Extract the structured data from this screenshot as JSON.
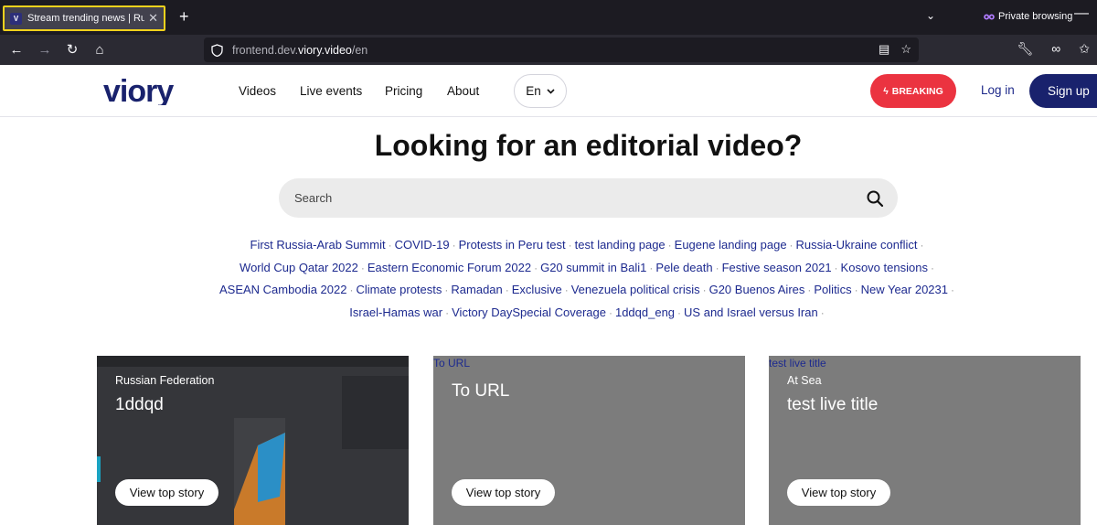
{
  "browser": {
    "tab_title": "Stream trending news | Ruptly",
    "tab_favicon": "V",
    "new_tab": "+",
    "tab_close": "✕",
    "private_label": "Private browsing",
    "url_prefix": "frontend.dev.",
    "url_host": "viory.video",
    "url_path": "/en",
    "icons": [
      "back-icon",
      "forward-icon",
      "reload-icon",
      "home-icon",
      "shield-icon",
      "reader-view-icon",
      "bookmark-star-icon",
      "wrench-icon",
      "mask-icon",
      "extensions-icon"
    ]
  },
  "header": {
    "nav": [
      "Videos",
      "Live events",
      "Pricing",
      "About"
    ],
    "language": "En",
    "breaking": "BREAKING",
    "login": "Log in",
    "signup": "Sign up",
    "brand_color": "#19226d",
    "breaking_color": "#eb3340"
  },
  "hero": {
    "title": "Looking for an editorial video?",
    "search_placeholder": "Search"
  },
  "tags": [
    [
      "First Russia-Arab Summit",
      "COVID-19",
      "Protests in Peru test",
      "test landing page",
      "Eugene landing page",
      "Russia-Ukraine conflict"
    ],
    [
      "World Cup Qatar 2022",
      "Eastern Economic Forum 2022",
      "G20 summit in Bali1",
      "Pele death",
      "Festive season 2021",
      "Kosovo tensions"
    ],
    [
      "ASEAN Cambodia 2022",
      "Climate protests",
      "Ramadan",
      "Exclusive",
      "Venezuela political crisis",
      "G20 Buenos Aires",
      "Politics",
      "New Year 20231"
    ],
    [
      "Israel-Hamas war",
      "Victory DaySpecial Coverage",
      "1ddqd_eng",
      "US and Israel versus Iran"
    ]
  ],
  "cards": [
    {
      "link": "",
      "country": "Russian Federation",
      "title": "1ddqd",
      "button": "View top story"
    },
    {
      "link": "To URL",
      "country": "",
      "title": "To URL",
      "button": "View top story"
    },
    {
      "link": "test live title",
      "country": "At Sea",
      "title": "test live title",
      "button": "View top story"
    }
  ]
}
